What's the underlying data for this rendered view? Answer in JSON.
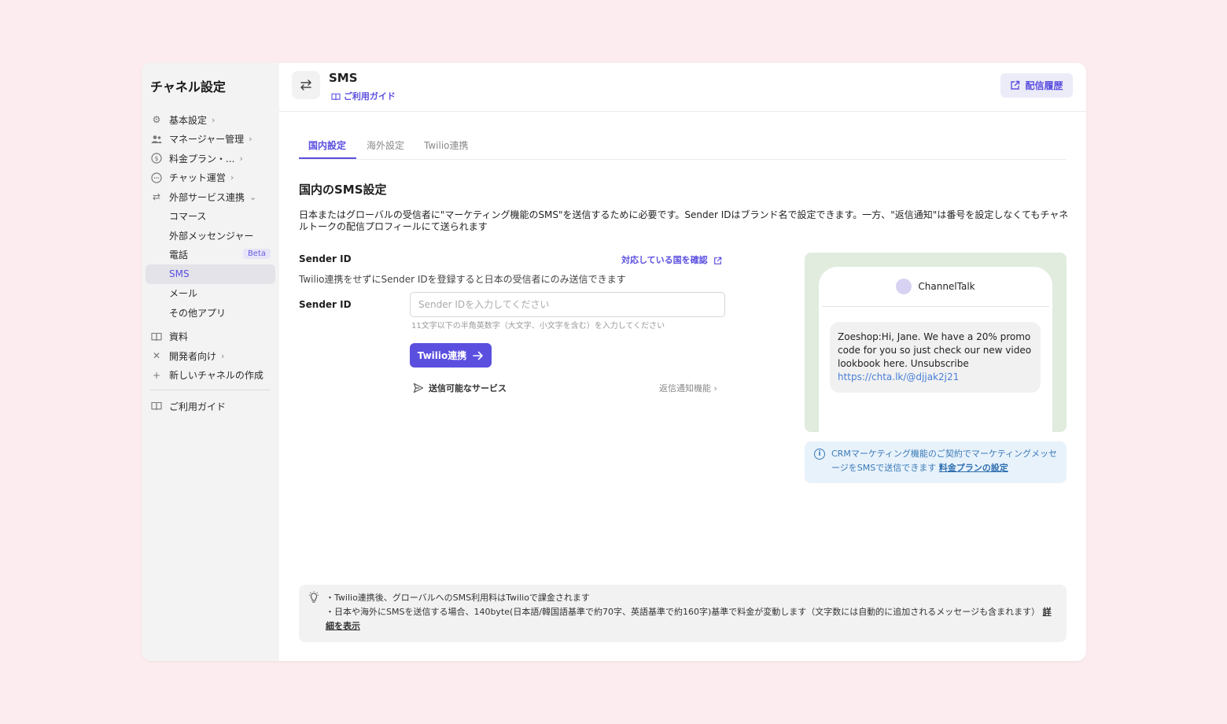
{
  "sidebar": {
    "title": "チャネル設定",
    "items": [
      {
        "label": "基本設定",
        "icon": "gear-icon",
        "chevron": ">"
      },
      {
        "label": "マネージャー管理",
        "icon": "users-icon",
        "chevron": ">"
      },
      {
        "label": "料金プラン・...",
        "icon": "dollar-icon",
        "chevron": ">"
      },
      {
        "label": "チャット運営",
        "icon": "chat-icon",
        "chevron": ">"
      },
      {
        "label": "外部サービス連携",
        "icon": "swap-icon",
        "chevron": "v"
      }
    ],
    "sub_items": [
      "コマース",
      "外部メッセンジャー",
      "電話",
      "SMS",
      "メール",
      "その他アプリ"
    ],
    "beta_label": "Beta",
    "items2": [
      {
        "label": "資料",
        "icon": "book-icon"
      },
      {
        "label": "開発者向け",
        "icon": "tools-icon",
        "chevron": ">"
      },
      {
        "label": "新しいチャネルの作成",
        "icon": "plus-icon"
      }
    ],
    "guide": "ご利用ガイド"
  },
  "header": {
    "title": "SMS",
    "guide_link": "ご利用ガイド",
    "history_button": "配信履歴"
  },
  "tabs": [
    "国内設定",
    "海外設定",
    "Twilio連携"
  ],
  "section": {
    "title": "国内のSMS設定",
    "description": "日本またはグローバルの受信者に\"マーケティング機能のSMS\"を送信するために必要です。Sender IDはブランド名で設定できます。一方、\"返信通知\"は番号を設定しなくてもチャネルトークの配信プロフィールにて送られます"
  },
  "sender": {
    "label": "Sender ID",
    "country_link": "対応している国を確認",
    "note": "Twilio連携をせずにSender IDを登録すると日本の受信者にのみ送信できます",
    "field_label": "Sender ID",
    "placeholder": "Sender IDを入力してください",
    "hint": "11文字以下の半角英数字（大文字、小文字を含む）を入力してください",
    "twilio_button": "Twilio連携",
    "service_label": "送信可能なサービス",
    "reply_label": "返信通知機能"
  },
  "preview": {
    "sender_name": "ChannelTalk",
    "message": "Zoeshop:Hi, Jane. We have a 20% promo code for you so just check our new video lookbook here.",
    "unsubscribe_label": "Unsubscribe",
    "unsubscribe_link": "https://chta.lk/@djjak2j21"
  },
  "info": {
    "text": "CRMマーケティング機能のご契約でマーケティングメッセージをSMSで送信できます",
    "link": "料金プランの設定"
  },
  "tips": {
    "line1": "・Twilio連携後、グローバルへのSMS利用料はTwilioで課金されます",
    "line2": "・日本や海外にSMSを送信する場合、140byte(日本語/韓国語基準で約70字、英語基準で約160字)基準で料金が変動します（文字数には自動的に追加されるメッセージも含まれます）",
    "link": "詳細を表示"
  },
  "colors": {
    "accent": "#5b4fe0",
    "background": "#fdecef",
    "preview_bg": "#e1ecdf",
    "info_bg": "#e8f2fb"
  }
}
